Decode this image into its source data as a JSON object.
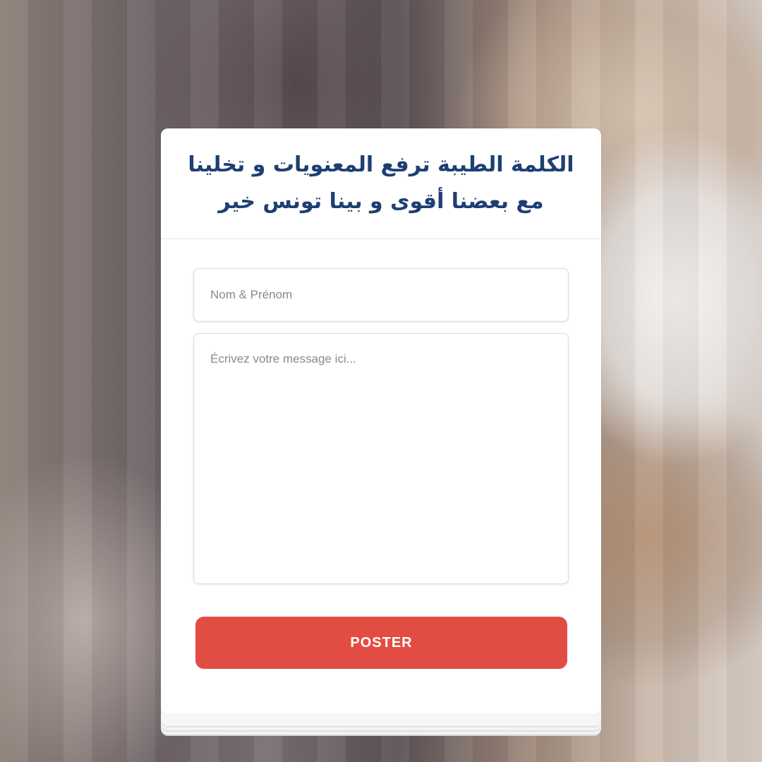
{
  "form": {
    "headline": "الكلمة الطيبة ترفع المعنويات و تخلينا مع بعضنا أقوى و بينا تونس خير",
    "name_placeholder": "Nom & Prénom",
    "name_value": "",
    "message_placeholder": "Écrivez votre message ici...",
    "message_value": "",
    "submit_label": "POSTER"
  },
  "colors": {
    "headline": "#1d3f73",
    "submit_button": "#e24d43",
    "card_background": "#ffffff"
  }
}
